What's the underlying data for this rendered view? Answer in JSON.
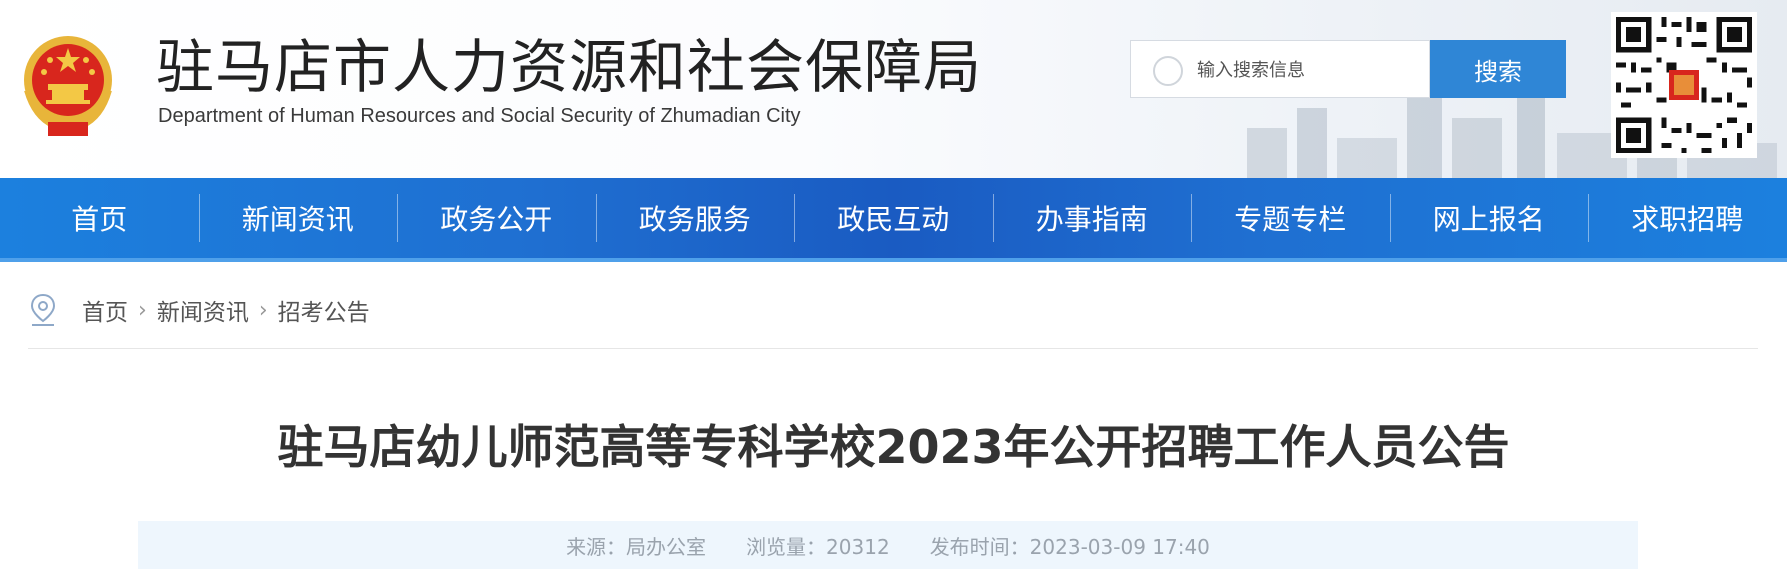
{
  "header": {
    "title_cn": "驻马店市人力资源和社会保障局",
    "title_en": "Department of Human Resources and Social Security of Zhumadian City",
    "emblem_icon": "national-emblem-icon",
    "qr_icon": "qr-code-icon"
  },
  "search": {
    "placeholder": "输入搜索信息",
    "button_label": "搜索",
    "button_color": "#2f86d6"
  },
  "nav": {
    "color": "#1f6fd1",
    "items": [
      {
        "label": "首页"
      },
      {
        "label": "新闻资讯"
      },
      {
        "label": "政务公开"
      },
      {
        "label": "政务服务"
      },
      {
        "label": "政民互动"
      },
      {
        "label": "办事指南"
      },
      {
        "label": "专题专栏"
      },
      {
        "label": "网上报名"
      },
      {
        "label": "求职招聘"
      }
    ]
  },
  "breadcrumb": {
    "icon": "location-pin-icon",
    "items": [
      "首页",
      "新闻资讯",
      "招考公告"
    ]
  },
  "article": {
    "title": "驻马店幼儿师范高等专科学校2023年公开招聘工作人员公告",
    "meta": {
      "source": "来源：局办公室",
      "views": "浏览量：20312",
      "published": "发布时间：2023-03-09 17:40"
    }
  }
}
